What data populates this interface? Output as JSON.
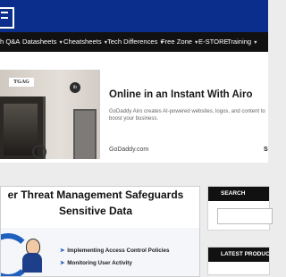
{
  "nav": {
    "items": [
      {
        "label": "h Q&A",
        "chevron": false
      },
      {
        "label": "Datasheets",
        "chevron": true
      },
      {
        "label": "Cheatsheets",
        "chevron": true
      },
      {
        "label": "Tech Differences",
        "chevron": true
      },
      {
        "label": "Free Zone",
        "chevron": true
      },
      {
        "label": "E-STORE",
        "chevron": false
      },
      {
        "label": "Training",
        "chevron": true
      }
    ],
    "chevron_glyph": "▼"
  },
  "ad": {
    "title": "Online in an Instant With Airo",
    "description": "GoDaddy Airo creates AI-powered websites, logos, and content to boost your business.",
    "source": "GoDaddy.com",
    "cta": "S",
    "photo_sign": "TGAG",
    "photo_badge": "ib"
  },
  "article": {
    "title_line1": "er Threat Management Safeguards",
    "title_line2": "Sensitive Data",
    "bullets": [
      "Implementing Access Control Policies",
      "Monitoring User Activity"
    ],
    "bullet_glyph": "➤"
  },
  "sidebar": {
    "search_heading": "SEARCH",
    "latest_heading": "LATEST PRODUCTS"
  },
  "colors": {
    "topbar": "#0b2e8c",
    "navbar": "#111111",
    "accent": "#1f5fbf"
  },
  "icons": {
    "logo": "menu-logo-icon",
    "nav_chevron": "chevron-down-icon"
  }
}
